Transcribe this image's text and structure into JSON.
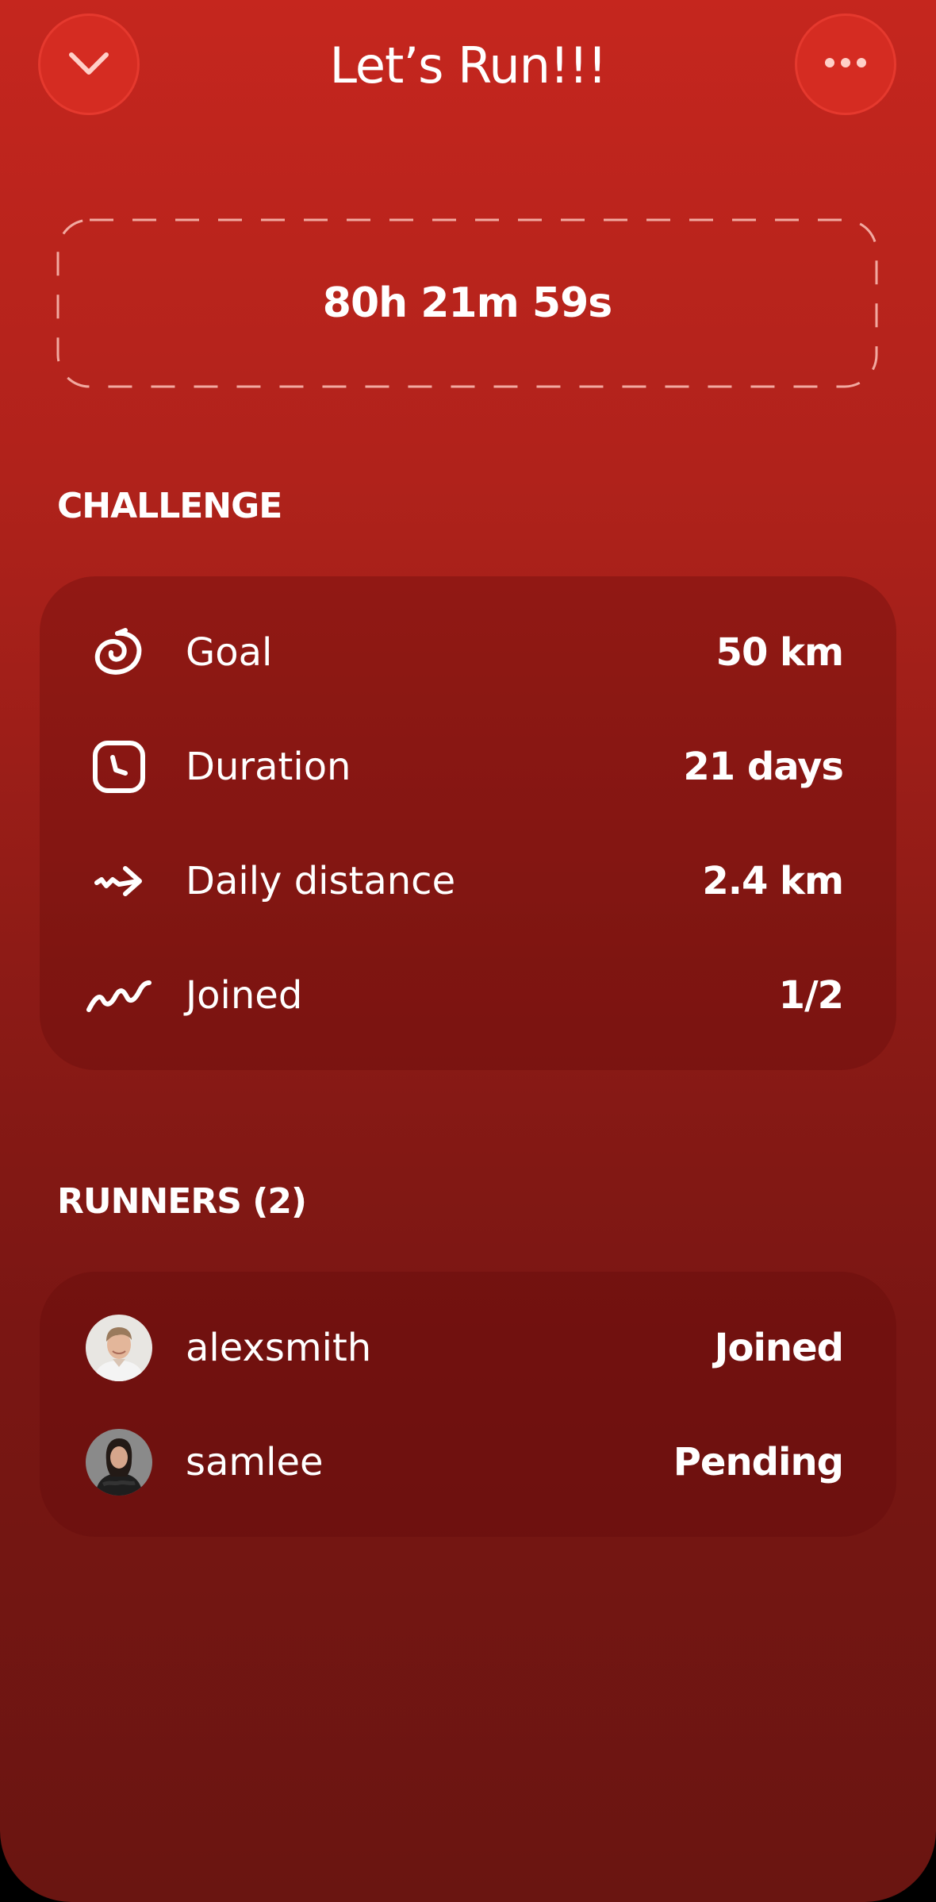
{
  "header": {
    "title": "Let’s Run!!!",
    "back_icon": "chevron-down-icon",
    "more_icon": "more-dots-icon",
    "button_color": "#d52c22"
  },
  "countdown": {
    "value": "80h 21m 59s"
  },
  "challenge": {
    "heading": "CHALLENGE",
    "items": [
      {
        "icon": "goal-icon",
        "label": "Goal",
        "value": "50 km"
      },
      {
        "icon": "duration-icon",
        "label": "Duration",
        "value": "21 days"
      },
      {
        "icon": "arrow-icon",
        "label": "Daily distance",
        "value": "2.4 km"
      },
      {
        "icon": "wave-icon",
        "label": "Joined",
        "value": "1/2"
      }
    ]
  },
  "runners": {
    "heading": "RUNNERS (2)",
    "items": [
      {
        "avatar": "avatar-alexsmith",
        "name": "alexsmith",
        "status": "Joined"
      },
      {
        "avatar": "avatar-samlee",
        "name": "samlee",
        "status": "Pending"
      }
    ]
  },
  "colors": {
    "background_top": "#c5261e",
    "background_bottom": "#6a1511",
    "card": "#5f0a08",
    "text": "#ffffff"
  }
}
